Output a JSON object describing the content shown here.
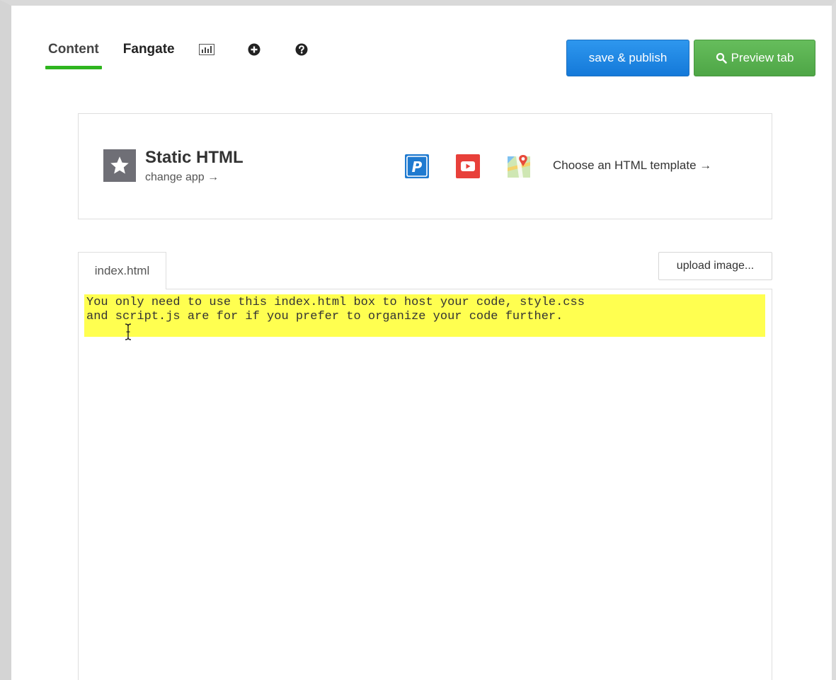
{
  "nav": {
    "tabs": [
      {
        "label": "Content",
        "active": true
      },
      {
        "label": "Fangate",
        "active": false
      }
    ],
    "icons": [
      "stats-icon",
      "add-circle-icon",
      "help-circle-icon"
    ]
  },
  "actions": {
    "publish_label": "save & publish",
    "preview_label": "Preview tab",
    "publish_color": "#1a80e0",
    "preview_color": "#58b04f"
  },
  "app": {
    "name": "Static HTML",
    "change_label": "change app →",
    "icon": "star-icon",
    "templates": [
      "paypal-icon",
      "youtube-icon",
      "google-maps-icon"
    ],
    "choose_template_label": "Choose an HTML template →"
  },
  "editor": {
    "file_tab_label": "index.html",
    "upload_label": "upload image...",
    "code_line_1": "You only need to use this index.html box to host your code, style.css",
    "code_line_2": "and script.js are for if you prefer to organize your code further.",
    "highlight_color": "#ffff50"
  }
}
